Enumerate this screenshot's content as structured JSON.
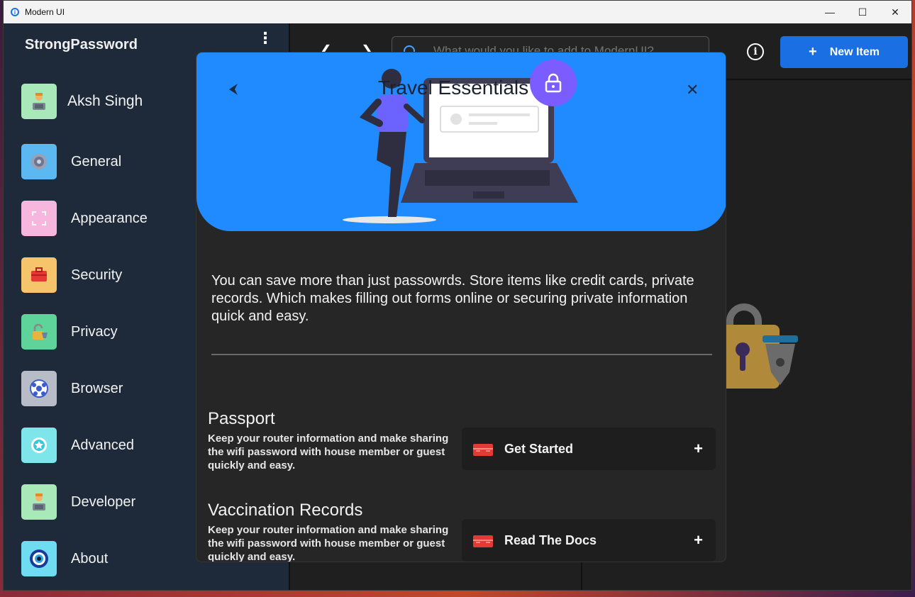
{
  "window": {
    "title": "Modern UI",
    "controls": {
      "minimize": "—",
      "maximize": "☐",
      "close": "✕"
    }
  },
  "sidebar": {
    "brand": "StrongPassword",
    "menu_icon": "⋮",
    "profile": {
      "name": "Aksh Singh"
    },
    "items": [
      {
        "label": "General",
        "icon": "gear-icon"
      },
      {
        "label": "Appearance",
        "icon": "frame-icon"
      },
      {
        "label": "Security",
        "icon": "toolbox-icon"
      },
      {
        "label": "Privacy",
        "icon": "padlock-icon"
      },
      {
        "label": "Browser",
        "icon": "globe-icon"
      },
      {
        "label": "Advanced",
        "icon": "star-badge-icon"
      },
      {
        "label": "Developer",
        "icon": "developer-avatar-icon"
      },
      {
        "label": "About",
        "icon": "eye-icon"
      }
    ]
  },
  "topbar": {
    "back": "❮",
    "forward": "❯",
    "search_placeholder": "What would you like to add to ModernUI?",
    "info": "i",
    "new_item": {
      "plus": "+",
      "label": "New Item"
    }
  },
  "dialog": {
    "title": "Travel Essentials",
    "close": "✕",
    "description": "You can save more than just passowrds. Store items like credit cards, private records. Which makes filling out forms online or securing private information quick and easy.",
    "sections": [
      {
        "title": "Passport",
        "text": "Keep your router information and make sharing the wifi password with house member or guest quickly and easy.",
        "action": "Get Started",
        "plus": "+"
      },
      {
        "title": "Vaccination Records",
        "text": "Keep your router information and make sharing the wifi password with house member or guest quickly and easy.",
        "action": "Read The Docs",
        "plus": "+"
      }
    ]
  },
  "colors": {
    "accent": "#1a6fe3",
    "hero": "#1f8bff",
    "badge": "#7a5cff",
    "sidebar": "#1e2a3a"
  }
}
